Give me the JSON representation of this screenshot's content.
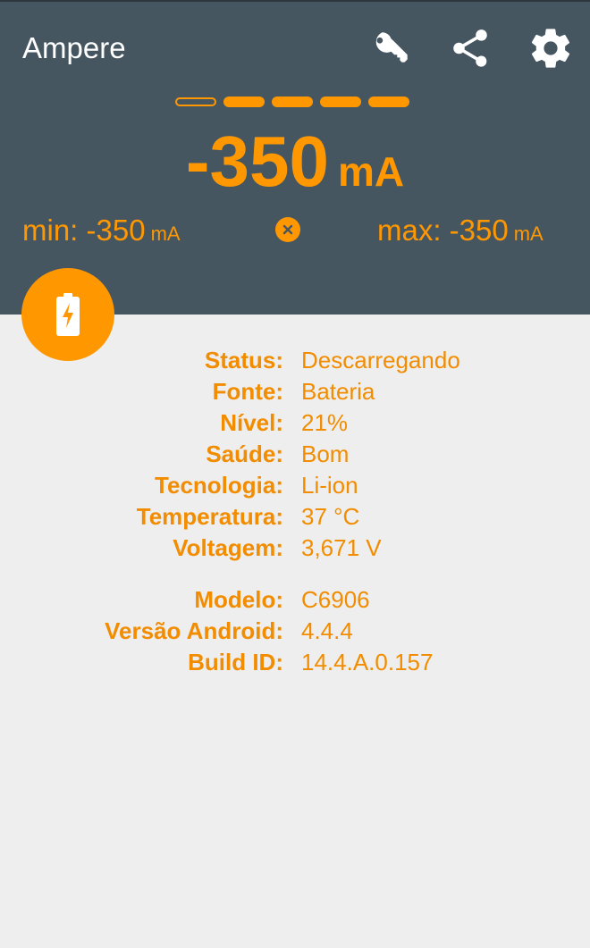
{
  "app": {
    "title": "Ampere"
  },
  "toolbar": {
    "actions": [
      {
        "name": "key-icon"
      },
      {
        "name": "share-icon"
      },
      {
        "name": "gear-icon"
      }
    ]
  },
  "colors": {
    "accent": "#ff9800",
    "header": "#465661",
    "background": "#eeeeee"
  },
  "meter": {
    "level_segments": 5,
    "filled_segments": 4,
    "current_value": "-350",
    "current_unit": "mA",
    "min_label": "min: -350",
    "min_unit": "mA",
    "max_label": "max: -350",
    "max_unit": "mA"
  },
  "battery_fab": {
    "icon": "battery-charging-icon"
  },
  "info": {
    "battery": [
      {
        "key": "Status:",
        "value": "Descarregando"
      },
      {
        "key": "Fonte:",
        "value": "Bateria"
      },
      {
        "key": "Nível:",
        "value": "21%"
      },
      {
        "key": "Saúde:",
        "value": "Bom"
      },
      {
        "key": "Tecnologia:",
        "value": "Li-ion"
      },
      {
        "key": "Temperatura:",
        "value": "37 °C"
      },
      {
        "key": "Voltagem:",
        "value": "3,671 V"
      }
    ],
    "device": [
      {
        "key": "Modelo:",
        "value": "C6906"
      },
      {
        "key": "Versão Android:",
        "value": "4.4.4"
      },
      {
        "key": "Build ID:",
        "value": "14.4.A.0.157"
      }
    ]
  }
}
